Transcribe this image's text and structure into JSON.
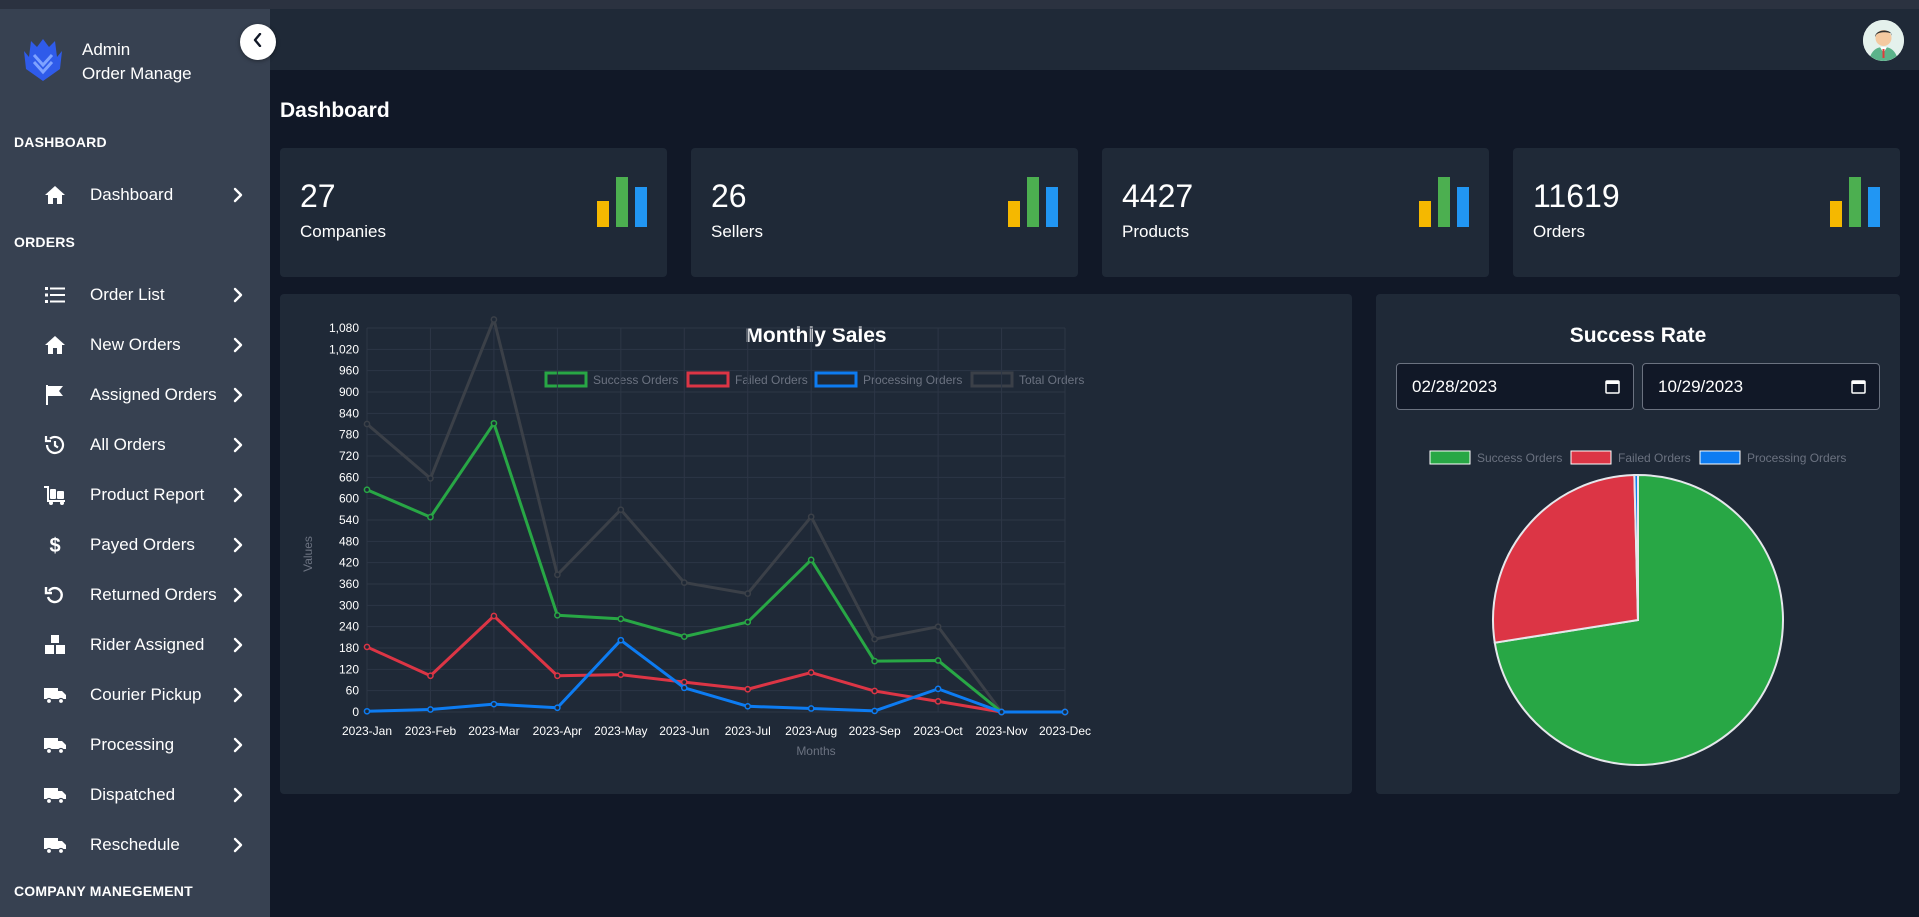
{
  "brand": {
    "line1": "Admin",
    "line2": "Order Manage"
  },
  "sidebar": {
    "sections": {
      "dashboard": "DASHBOARD",
      "orders": "ORDERS",
      "company": "COMPANY MANEGEMENT"
    },
    "items": [
      {
        "label": "Dashboard",
        "icon": "home-icon"
      },
      {
        "label": "Order List",
        "icon": "list-icon"
      },
      {
        "label": "New Orders",
        "icon": "home-icon"
      },
      {
        "label": "Assigned Orders",
        "icon": "flag-icon"
      },
      {
        "label": "All Orders",
        "icon": "history-icon"
      },
      {
        "label": "Product Report",
        "icon": "luggage-cart-icon"
      },
      {
        "label": "Payed Orders",
        "icon": "dollar-icon"
      },
      {
        "label": "Returned Orders",
        "icon": "undo-icon"
      },
      {
        "label": "Rider Assigned",
        "icon": "boxes-icon"
      },
      {
        "label": "Courier Pickup",
        "icon": "truck-icon"
      },
      {
        "label": "Processing",
        "icon": "truck-icon"
      },
      {
        "label": "Dispatched",
        "icon": "truck-icon"
      },
      {
        "label": "Reschedule",
        "icon": "truck-icon"
      }
    ]
  },
  "page": {
    "title": "Dashboard"
  },
  "stats": [
    {
      "value": "27",
      "label": "Companies"
    },
    {
      "value": "26",
      "label": "Sellers"
    },
    {
      "value": "4427",
      "label": "Products"
    },
    {
      "value": "11619",
      "label": "Orders"
    }
  ],
  "colors": {
    "success": "#28a745",
    "failed": "#dc3545",
    "processing": "#0d7cf2",
    "total": "#3b4048",
    "bar_yellow": "#f5b800",
    "bar_green": "#4caf50",
    "bar_blue": "#2196f3"
  },
  "monthly": {
    "title": "Monthly Sales"
  },
  "success_rate": {
    "title": "Success Rate",
    "date_from": "02/28/2023",
    "date_to": "10/29/2023"
  },
  "chart_data": [
    {
      "type": "line",
      "title": "Monthly Sales",
      "xlabel": "Months",
      "ylabel": "Values",
      "categories": [
        "2023-Jan",
        "2023-Feb",
        "2023-Mar",
        "2023-Apr",
        "2023-May",
        "2023-Jun",
        "2023-Jul",
        "2023-Aug",
        "2023-Sep",
        "2023-Oct",
        "2023-Nov",
        "2023-Dec"
      ],
      "ylim": [
        0,
        1080
      ],
      "yticks": [
        0,
        60,
        120,
        180,
        240,
        300,
        360,
        420,
        480,
        540,
        600,
        660,
        720,
        780,
        840,
        900,
        960,
        1020,
        1080
      ],
      "legend": "top",
      "series": [
        {
          "name": "Success Orders",
          "values": [
            625,
            548,
            812,
            272,
            262,
            212,
            253,
            428,
            143,
            145,
            0,
            0
          ]
        },
        {
          "name": "Failed Orders",
          "values": [
            183,
            102,
            270,
            102,
            105,
            84,
            64,
            111,
            59,
            30,
            0,
            0
          ]
        },
        {
          "name": "Processing Orders",
          "values": [
            2,
            7,
            22,
            12,
            202,
            68,
            16,
            10,
            3,
            65,
            0,
            0
          ]
        },
        {
          "name": "Total Orders",
          "values": [
            810,
            657,
            1104,
            386,
            569,
            364,
            333,
            549,
            205,
            240,
            0,
            0
          ]
        }
      ]
    },
    {
      "type": "pie",
      "title": "Success Rate",
      "legend": "top",
      "labels": [
        "Success Orders",
        "Failed Orders",
        "Processing Orders"
      ],
      "values": [
        72.5,
        27.1,
        0.4
      ]
    }
  ]
}
